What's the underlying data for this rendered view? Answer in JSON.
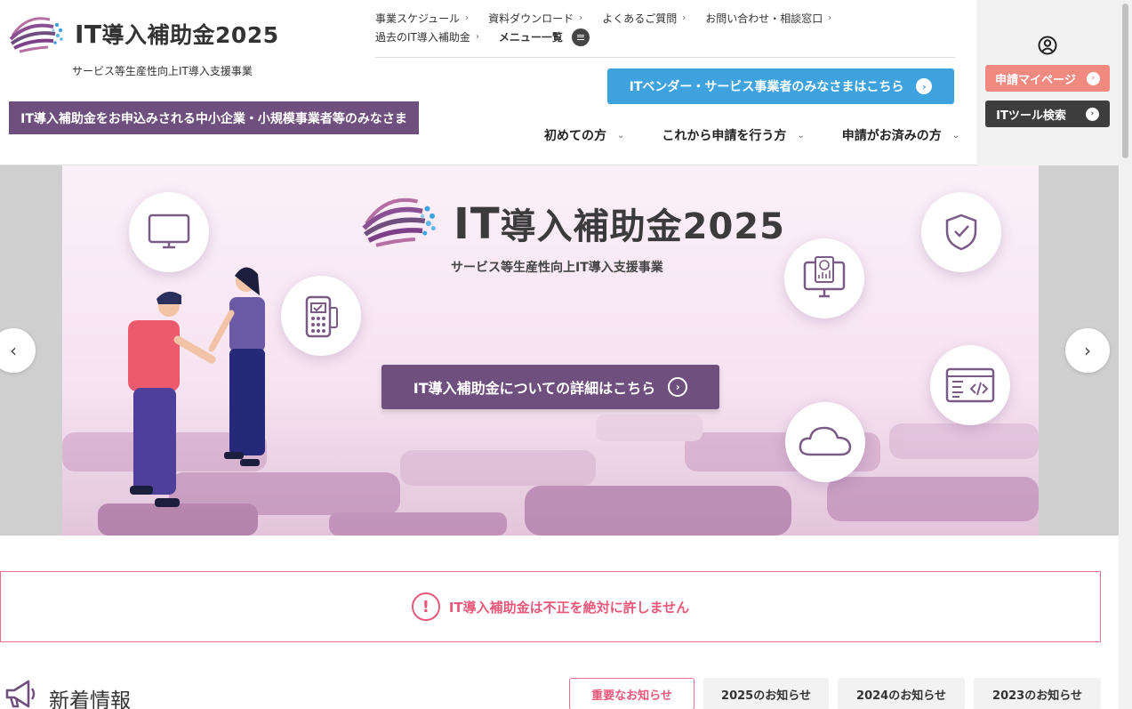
{
  "header": {
    "logo_it": "IT",
    "logo_rest": "導入補助金2025",
    "logo_sub": "サービス等生産性向上IT導入支援事業",
    "sme_banner": "IT導入補助金をお申込みされる中小企業・小規模事業者等のみなさま",
    "util_nav": {
      "schedule": "事業スケジュール",
      "downloads": "資料ダウンロード",
      "faq": "よくあるご質問",
      "contact": "お問い合わせ・相談窓口",
      "past": "過去のIT導入補助金",
      "menu": "メニュー一覧"
    },
    "vendor_button": "ITベンダー・サービス事業者のみなさまはこちら",
    "main_nav": {
      "first": "初めての方",
      "applying": "これから申請を行う方",
      "applied": "申請がお済みの方"
    },
    "mypage_button": "申請マイページ",
    "tool_search_button": "ITツール検索"
  },
  "hero": {
    "title_it": "IT",
    "title_rest": "導入補助金2025",
    "subtitle": "サービス等生産性向上IT導入支援事業",
    "cta": "IT導入補助金についての詳細はこちら"
  },
  "alert": {
    "text": "IT導入補助金は不正を絶対に許しません"
  },
  "news": {
    "title": "新着情報",
    "tabs": {
      "important": "重要なお知らせ",
      "y2025": "2025のお知らせ",
      "y2024": "2024のお知らせ",
      "y2023": "2023のお知らせ"
    }
  },
  "colors": {
    "brand_purple": "#6f4f7e",
    "vendor_blue": "#3ea2df",
    "mypage_salmon": "#f08a80",
    "alert_pink": "#e8587a"
  },
  "icons": [
    "logo-mark",
    "user-icon",
    "menu-icon",
    "monitor-icon",
    "payment-terminal-icon",
    "shield-check-icon",
    "invoice-monitor-icon",
    "code-window-icon",
    "cloud-icon",
    "megaphone-icon",
    "exclamation-icon",
    "chevron-left-icon",
    "chevron-right-icon"
  ]
}
